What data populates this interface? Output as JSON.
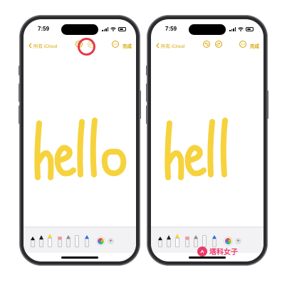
{
  "phones": [
    {
      "id": "left",
      "status": {
        "time": "7:59"
      },
      "nav": {
        "back_label": "所有 iCloud",
        "done_label": "完成"
      },
      "highlight_undo": true,
      "drawing_text": "hello"
    },
    {
      "id": "right",
      "status": {
        "time": "7:59"
      },
      "nav": {
        "back_label": "所有 iCloud",
        "done_label": "完成"
      },
      "highlight_undo": false,
      "drawing_text": "hell"
    }
  ],
  "colors": {
    "accent": "#d9a400",
    "ink": "#f6d23d",
    "highlight": "#e63946",
    "watermark": "#ea3a6a"
  },
  "icons": {
    "back": "chevron-left-icon",
    "undo": "undo-icon",
    "redo": "redo-icon",
    "more": "ellipsis-circle-icon",
    "palette": "color-wheel-icon",
    "add": "plus-icon"
  },
  "watermark": {
    "text": "塔科女子"
  }
}
